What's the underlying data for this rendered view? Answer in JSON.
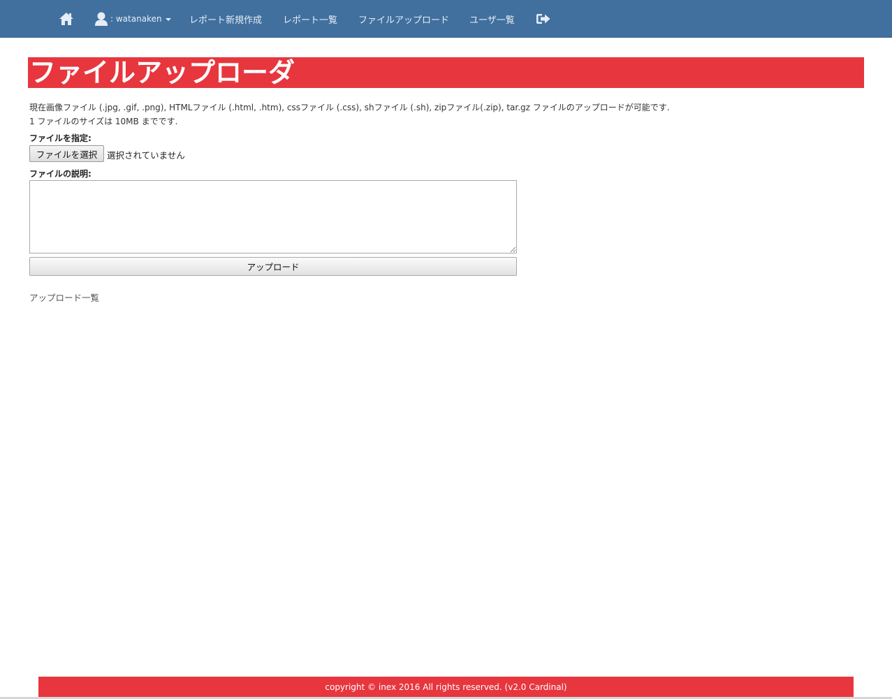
{
  "navbar": {
    "home_icon": "home-icon",
    "user_icon": "user-icon",
    "user_label": ": watanaken",
    "report_new": "レポート新規作成",
    "report_list": "レポート一覧",
    "file_upload": "ファイルアップロード",
    "user_list": "ユーザ一覧",
    "logout_icon": "sign-out-icon",
    "bar_color": "#41709f"
  },
  "page": {
    "title": "ファイルアップローダ",
    "title_bar_color": "#e8363e",
    "description_line1": "現在画像ファイル (.jpg, .gif, .png), HTMLファイル (.html, .htm), cssファイル (.css), shファイル (.sh), zipファイル(.zip), tar.gz ファイルのアップロードが可能です.",
    "description_line2": "1 ファイルのサイズは 10MB までです."
  },
  "form": {
    "file_label": "ファイルを指定:",
    "file_button": "ファイルを選択",
    "file_status": "選択されていません",
    "description_label": "ファイルの説明:",
    "description_value": "",
    "upload_button": "アップロード"
  },
  "links": {
    "upload_list": "アップロード一覧"
  },
  "footer": {
    "text": "copyright © inex 2016 All rights reserved. (v2.0 Cardinal)",
    "color": "#e8363e"
  }
}
